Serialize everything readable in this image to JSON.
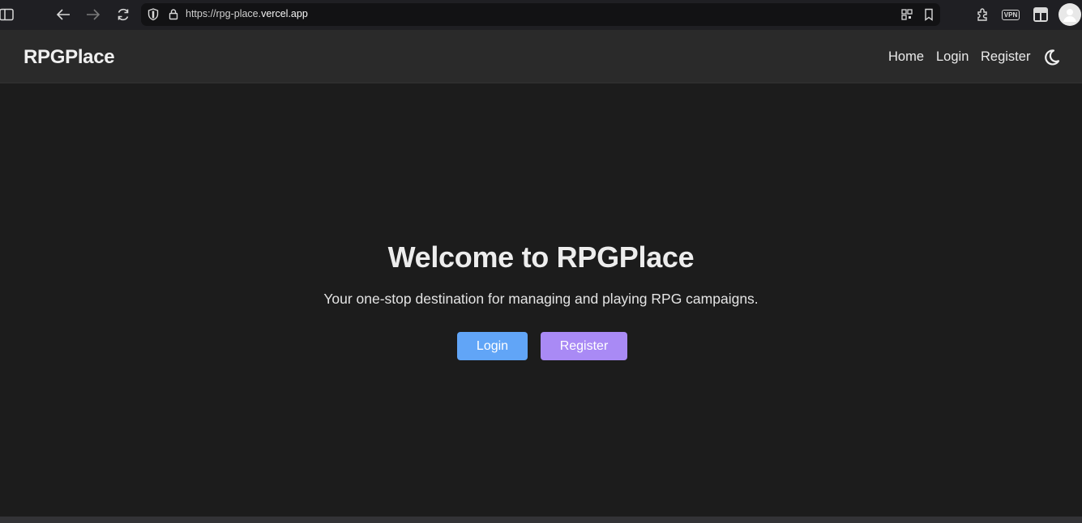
{
  "browser": {
    "url_prefix": "https://rpg-place.",
    "url_host": "vercel.app",
    "vpn_label": "VPN"
  },
  "header": {
    "brand": "RPGPlace",
    "nav": [
      {
        "label": "Home"
      },
      {
        "label": "Login"
      },
      {
        "label": "Register"
      }
    ],
    "theme_icon": "moon-icon"
  },
  "hero": {
    "title": "Welcome to RPGPlace",
    "subtitle": "Your one-stop destination for managing and playing RPG campaigns.",
    "login_label": "Login",
    "register_label": "Register"
  },
  "colors": {
    "login_button": "#61a5f7",
    "register_button": "#a98af5",
    "background": "#1c1c1c",
    "header": "#2a2a2a"
  }
}
